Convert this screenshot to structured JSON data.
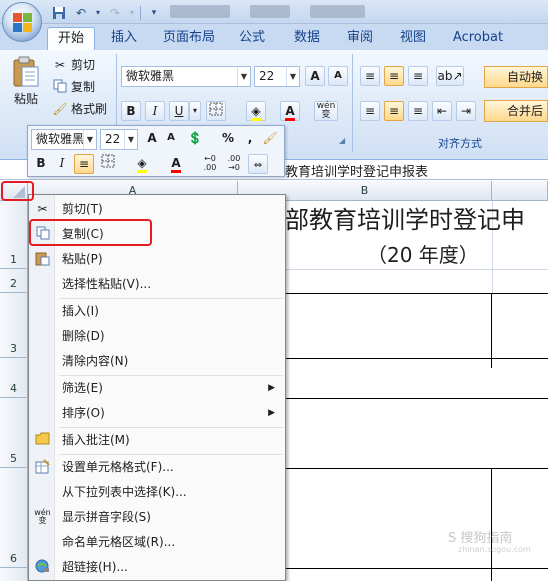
{
  "quick_access": {
    "save_icon": "save-icon",
    "undo_icon": "undo-icon",
    "redo_icon": "redo-icon",
    "customize_icon": "customize-qat-icon"
  },
  "tabs": [
    "开始",
    "插入",
    "页面布局",
    "公式",
    "数据",
    "审阅",
    "视图",
    "Acrobat"
  ],
  "ribbon": {
    "clipboard": {
      "paste_label": "粘贴",
      "cut_label": "剪切",
      "copy_label": "复制",
      "format_painter_label": "格式刷"
    },
    "font": {
      "font_name": "微软雅黑",
      "font_size": "22",
      "grow_label": "A",
      "shrink_label": "A",
      "bold": "B",
      "italic": "I",
      "underline": "U",
      "font_color": "A",
      "phonetic": "wén 变"
    },
    "alignment": {
      "wrap_text_label": "自动换行",
      "merge_label": "合并后居",
      "group_label": "对齐方式"
    }
  },
  "mini_toolbar": {
    "font_name": "微软雅黑",
    "font_size": "22",
    "percent": "%",
    "comma": ",",
    "bold": "B",
    "italic": "I"
  },
  "formula_bar": {
    "content": "教育培训学时登记申报表"
  },
  "sheet": {
    "column_a": "A",
    "column_b": "B",
    "rows": [
      "1",
      "2",
      "3",
      "4",
      "5",
      "6"
    ],
    "title_cell": "部教育培训学时登记申",
    "subtitle_cell": "（20  年度）"
  },
  "context_menu": {
    "items": [
      {
        "label": "剪切(T)",
        "icon": "scissors-icon"
      },
      {
        "label": "复制(C)",
        "icon": "copy-icon"
      },
      {
        "label": "粘贴(P)",
        "icon": "paste-icon"
      },
      {
        "label": "选择性粘贴(V)...",
        "icon": ""
      },
      {
        "label": "插入(I)",
        "icon": ""
      },
      {
        "label": "删除(D)",
        "icon": ""
      },
      {
        "label": "清除内容(N)",
        "icon": ""
      },
      {
        "label": "筛选(E)",
        "icon": ""
      },
      {
        "label": "排序(O)",
        "icon": ""
      },
      {
        "label": "插入批注(M)",
        "icon": "comment-icon"
      },
      {
        "label": "设置单元格格式(F)...",
        "icon": "format-cells-icon"
      },
      {
        "label": "从下拉列表中选择(K)...",
        "icon": ""
      },
      {
        "label": "显示拼音字段(S)",
        "icon": "phonetic-icon"
      },
      {
        "label": "命名单元格区域(R)...",
        "icon": ""
      },
      {
        "label": "超链接(H)...",
        "icon": "hyperlink-icon"
      }
    ]
  },
  "watermark": {
    "text": "S 搜狗指南",
    "sub": "zhinan.sogou.com"
  },
  "colors": {
    "highlight": "#e31b23",
    "ribbon_text": "#15428b"
  }
}
